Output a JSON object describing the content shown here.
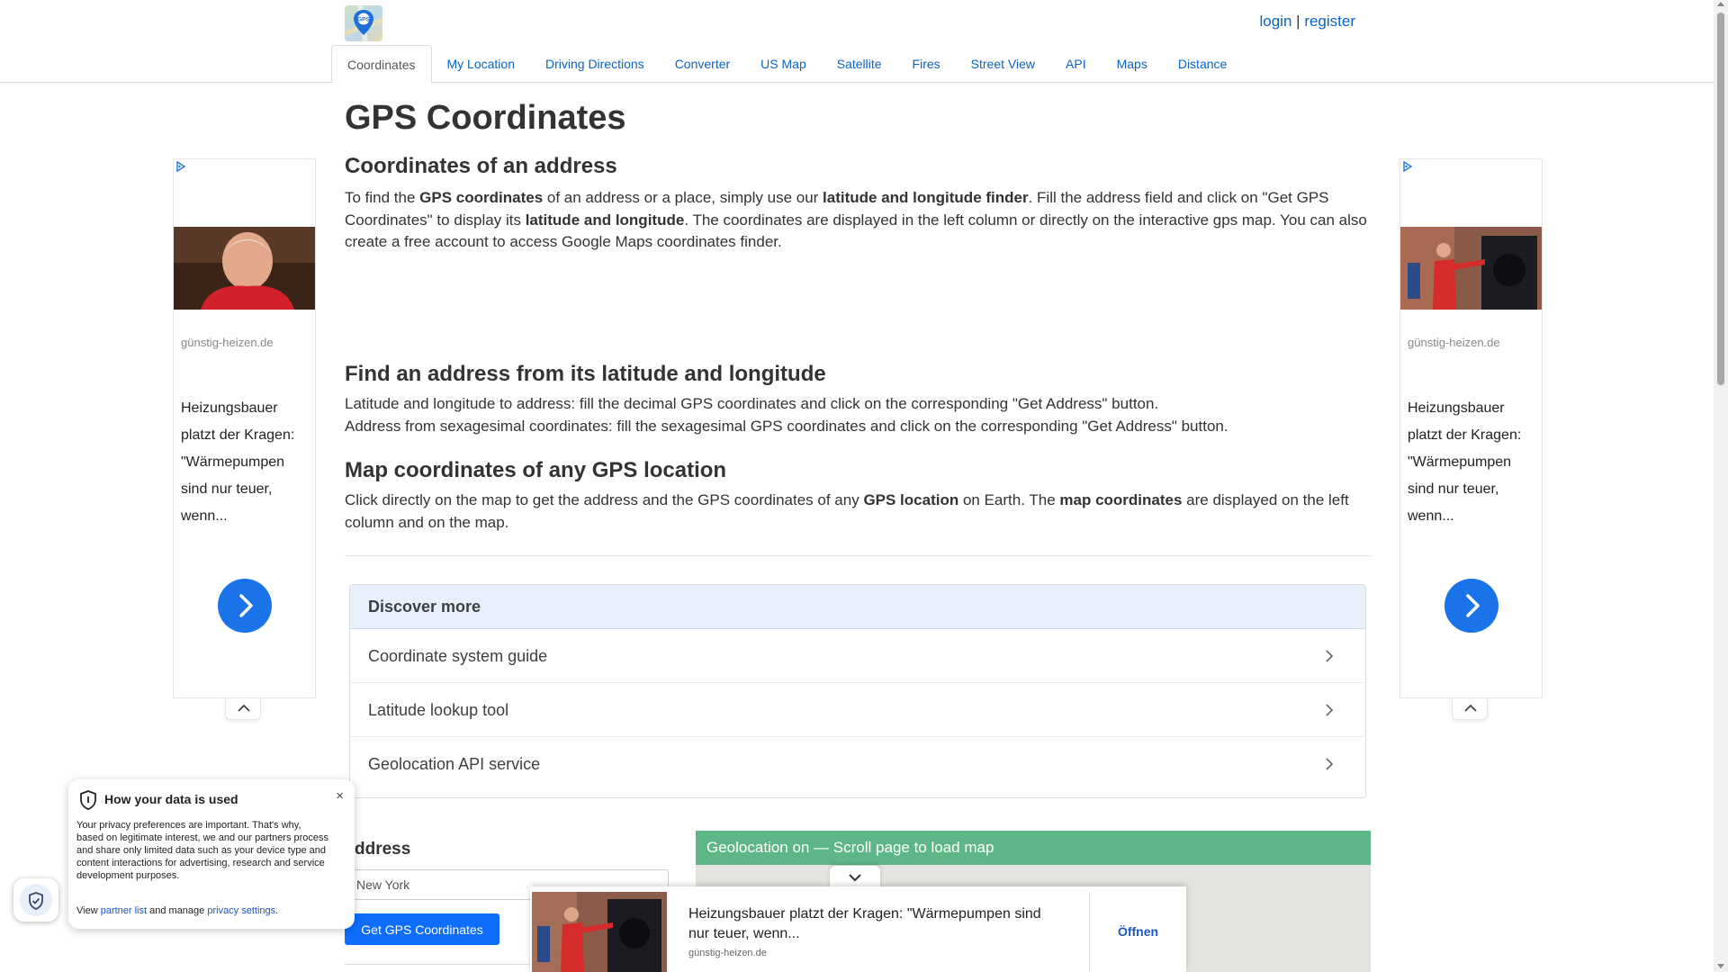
{
  "header": {
    "logo_alt": "GPS",
    "login": "login",
    "separator": "|",
    "register": "register"
  },
  "tabs": [
    "Coordinates",
    "My Location",
    "Driving Directions",
    "Converter",
    "US Map",
    "Satellite",
    "Fires",
    "Street View",
    "API",
    "Maps",
    "Distance"
  ],
  "main": {
    "title": "GPS Coordinates",
    "section1": {
      "heading": "Coordinates of an address",
      "t1": "To find the ",
      "b1": "GPS coordinates",
      "t2": " of an address or a place, simply use our ",
      "b2": "latitude and longitude finder",
      "t3": ". Fill the address field and click on \"Get GPS Coordinates\" to display its ",
      "b3": "latitude and longitude",
      "t4": ". The coordinates are displayed in the left column or directly on the interactive gps map. You can also create a free account to access Google Maps coordinates finder."
    },
    "section2": {
      "heading": "Find an address from its latitude and longitude",
      "line1": "Latitude and longitude to address: fill the decimal GPS coordinates and click on the corresponding \"Get Address\" button.",
      "line2": "Address from sexagesimal coordinates: fill the sexagesimal GPS coordinates and click on the corresponding \"Get Address\" button."
    },
    "section3": {
      "heading": "Map coordinates of any GPS location",
      "t1": "Click directly on the map to get the address and the GPS coordinates of any ",
      "b1": "GPS location",
      "t2": " on Earth. The ",
      "b2": "map coordinates",
      "t3": " are displayed on the left column and on the map."
    }
  },
  "discover": {
    "heading": "Discover more",
    "items": [
      "Coordinate system guide",
      "Latitude lookup tool",
      "Geolocation API service"
    ]
  },
  "form": {
    "label": "ddress",
    "input_value": "New York",
    "button": "Get GPS Coordinates"
  },
  "map": {
    "banner": "Geolocation on — Scroll page to load map"
  },
  "side_ad": {
    "domain": "günstig-heizen.de",
    "headline": "Heizungsbauer platzt der Kragen: \"Wärmepumpen sind nur teuer, wenn..."
  },
  "privacy": {
    "title": "How your data is used",
    "close": "×",
    "body": "Your privacy preferences are important. That's why, based on legitimate interest, we and our partners process and share only limited data such as your device type and content interactions for advertising, research and service development purposes.",
    "foot_view": "View ",
    "partner_list": "partner list",
    "foot_manage": " and manage ",
    "privacy_settings": "privacy settings",
    "foot_end": "."
  },
  "anchor_ad": {
    "headline": "Heizungsbauer platzt der Kragen: \"Wärmepumpen sind nur teuer, wenn...",
    "domain": "günstig-heizen.de",
    "cta": "Öffnen"
  },
  "colors": {
    "link": "#0b63c5",
    "map_banner": "#5cb685",
    "button": "#0d6efd",
    "discover_head": "#e8f0fe",
    "ad_button": "#1a73e8"
  }
}
